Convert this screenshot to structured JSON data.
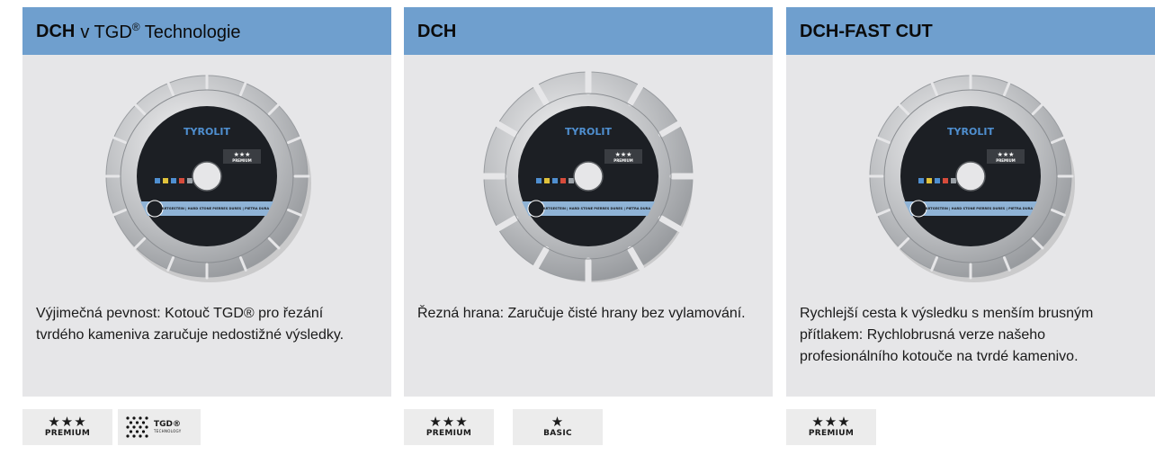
{
  "cards": [
    {
      "title_bold": "DCH",
      "title_light": "v TGD",
      "title_sup": "®",
      "title_tail": " Technologie",
      "description": "Výjimečná pevnost: Kotouč TGD® pro řezání tvrdého kameniva zaručuje nedostižné výsledky.",
      "disc": {
        "brand": "TYROLIT",
        "rating_stars": "★★★",
        "rating_label": "PREMIUM",
        "band_text": "HARTGESTEIN | HARD STONE PIERRES DURES | PIETRA DURA",
        "style": "segmented-fine"
      },
      "badges": [
        {
          "type": "premium",
          "stars": "★★★",
          "label": "PREMIUM"
        },
        {
          "type": "tgd",
          "label": "TGD®",
          "sublabel": "TECHNOLOGY"
        }
      ]
    },
    {
      "title_bold": "DCH",
      "title_light": "",
      "title_sup": "",
      "title_tail": "",
      "description": "Řezná hrana: Zaručuje čisté hrany bez vylamování.",
      "disc": {
        "brand": "TYROLIT",
        "rating_stars": "★★★",
        "rating_label": "PREMIUM",
        "band_text": "HARTGESTEIN | HARD STONE PIERRES DURES | PIETRA DURA",
        "style": "segmented-gapped"
      },
      "badges": [
        {
          "type": "premium",
          "stars": "★★★",
          "label": "PREMIUM"
        },
        {
          "type": "basic",
          "stars": "★",
          "label": "BASIC"
        }
      ]
    },
    {
      "title_bold": "DCH-FAST CUT",
      "title_light": "",
      "title_sup": "",
      "title_tail": "",
      "description": "Rychlejší cesta k výsledku s menším brusným přítlakem: Rychlobrusná verze našeho profesionálního kotouče na tvrdé kamenivo.",
      "disc": {
        "brand": "TYROLIT",
        "rating_stars": "★★★",
        "rating_label": "PREMIUM",
        "band_text": "HARTGESTEIN | HARD STONE PIERRES DURES | PIETRA DURA",
        "style": "segmented-fine"
      },
      "badges": [
        {
          "type": "premium",
          "stars": "★★★",
          "label": "PREMIUM"
        }
      ]
    }
  ],
  "colors": {
    "header_bg": "#6f9fce",
    "card_bg": "#e6e6e8",
    "badge_bg": "#ececec",
    "disc_label": "#1c1f24",
    "disc_band": "#8fb3d6"
  }
}
